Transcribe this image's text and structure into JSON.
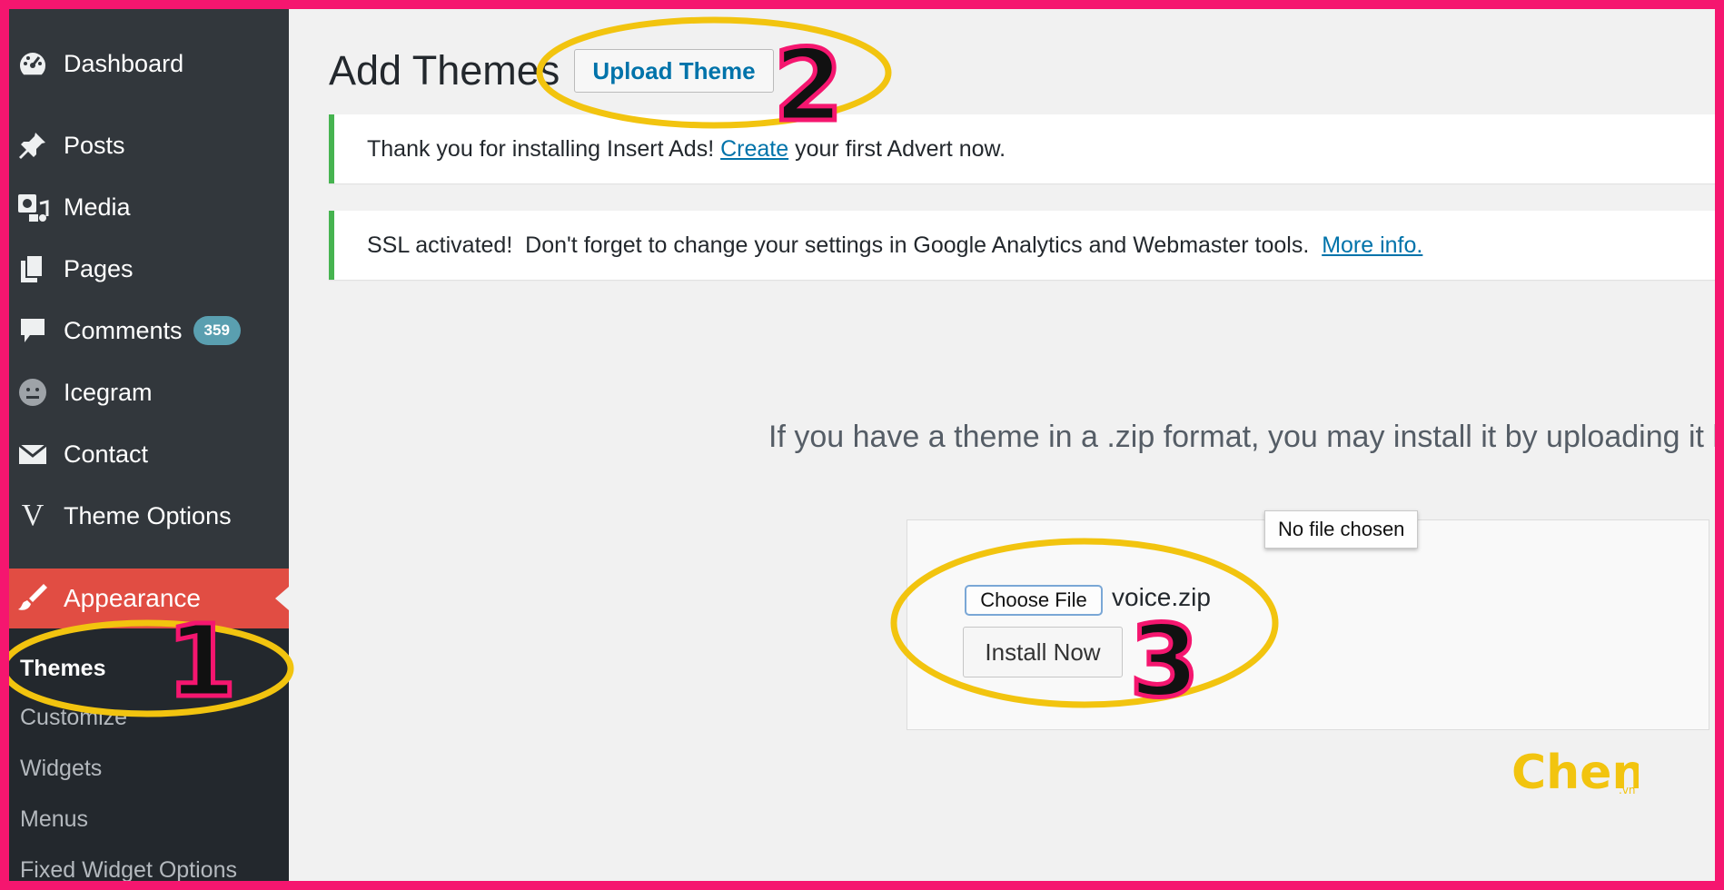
{
  "sidebar": {
    "items": [
      {
        "label": "Dashboard",
        "icon": "dashboard-icon"
      },
      {
        "label": "Posts",
        "icon": "pin-icon"
      },
      {
        "label": "Media",
        "icon": "media-icon"
      },
      {
        "label": "Pages",
        "icon": "pages-icon"
      },
      {
        "label": "Comments",
        "icon": "comment-icon",
        "badge": "359"
      },
      {
        "label": "Icegram",
        "icon": "icegram-icon"
      },
      {
        "label": "Contact",
        "icon": "envelope-icon"
      },
      {
        "label": "Theme Options",
        "icon": "v-logo-icon",
        "glyph": "V"
      }
    ],
    "appearance": {
      "label": "Appearance",
      "icon": "paintbrush-icon"
    },
    "submenu": [
      "Themes",
      "Customize",
      "Widgets",
      "Menus",
      "Fixed Widget Options"
    ]
  },
  "header": {
    "title": "Add Themes",
    "upload_button": "Upload Theme"
  },
  "notices": {
    "ads": {
      "before": "Thank you for installing Insert Ads! ",
      "link": "Create",
      "after": " your first Advert now."
    },
    "ssl": {
      "text": "SSL activated!  Don't forget to change your settings in Google Analytics and Webmaster tools.  ",
      "link": "More info."
    }
  },
  "upload": {
    "description": "If you have a theme in a .zip format, you may install it by uploading it here.",
    "choose_button": "Choose File",
    "filename": "voice.zip",
    "install_button": "Install Now",
    "tooltip": "No file chosen"
  },
  "annotations": {
    "step1": "1",
    "step2": "2",
    "step3": "3",
    "ellipse_color": "#f2c40f",
    "number_stroke": "#f5166f",
    "frame_color": "#f5166f"
  },
  "logo": {
    "text": "Cheng",
    "suffix": ".vn"
  }
}
